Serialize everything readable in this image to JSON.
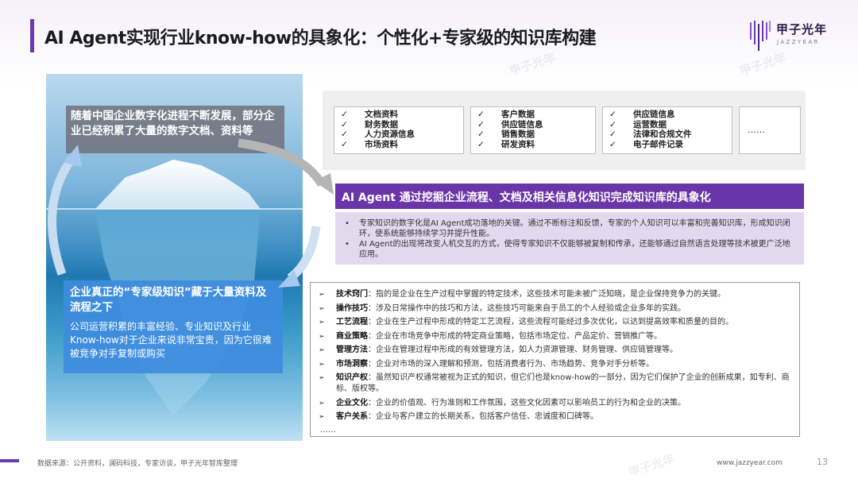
{
  "title": "AI Agent实现行业know-how的具象化：个性化+专家级的知识库构建",
  "logo": {
    "zh": "甲子光年",
    "en": "JAZZYEAR",
    "watermark": "甲子光年"
  },
  "iceberg": {
    "top_text": "随着中国企业数字化进程不断发展，部分企业已经积累了大量的数字文档、资料等",
    "bottom_heading": "企业真正的“专家级知识”藏于大量资料及流程之下",
    "bottom_body": "公司运营积累的丰富经验、专业知识及行业Know-how对于企业来说非常宝贵，因为它很难被竞争对手复制或购买"
  },
  "categories": [
    {
      "items": [
        "文档资料",
        "财务数据",
        "人力资源信息",
        "市场资料"
      ]
    },
    {
      "items": [
        "客户数据",
        "供应链信息",
        "销售数据",
        "研发资料"
      ]
    },
    {
      "items": [
        "供应链信息",
        "运营数据",
        "法律和合规文件",
        "电子邮件记录"
      ]
    }
  ],
  "categories_more": "……",
  "check_glyph": "✓",
  "purple": {
    "heading": "AI Agent 通过挖掘企业流程、文档及相关信息化知识完成知识库的具象化",
    "bullet": "•",
    "points": [
      "专家知识的数字化是AI Agent成功落地的关键。通过不断标注和反馈，专家的个人知识可以丰富和完善知识库，形成知识闭环，使系统能够持续学习并提升性能。",
      "AI Agent的出现将改变人机交互的方式，使得专家知识不仅能够被复制和传承，还能够通过自然语言处理等技术被更广泛地应用。"
    ]
  },
  "knowledge": {
    "arrow": "➢",
    "items": [
      {
        "term": "技术窍门",
        "desc": "：指的是企业在生产过程中掌握的特定技术，这些技术可能未被广泛知晓，是企业保持竞争力的关键。"
      },
      {
        "term": "操作技巧",
        "desc": "：涉及日常操作中的技巧和方法，这些技巧可能来自于员工的个人经验或企业多年的实践。"
      },
      {
        "term": "工艺流程",
        "desc": "：企业在生产过程中形成的特定工艺流程，这些流程可能经过多次优化，以达到提高效率和质量的目的。"
      },
      {
        "term": "商业策略",
        "desc": "：企业在市场竞争中形成的特定商业策略，包括市场定位、产品定价、营销推广等。"
      },
      {
        "term": "管理方法",
        "desc": "：企业在管理过程中形成的有效管理方法，如人力资源管理、财务管理、供应链管理等。"
      },
      {
        "term": "市场洞察",
        "desc": "：企业对市场的深入理解和预测，包括消费者行为、市场趋势、竞争对手分析等。"
      },
      {
        "term": "知识产权",
        "desc": "：虽然知识产权通常被视为正式的知识，但它们也是know-how的一部分，因为它们保护了企业的创新成果，如专利、商标、版权等。"
      },
      {
        "term": "企业文化",
        "desc": "：企业的价值观、行为准则和工作氛围，这些文化因素可以影响员工的行为和企业的决策。"
      },
      {
        "term": "客户关系",
        "desc": "：企业与客户建立的长期关系，包括客户信任、忠诚度和口碑等。"
      }
    ],
    "more": "……"
  },
  "footer": {
    "source": "数据来源：公开资料，澜码科技，专家访谈，甲子光年智库整理",
    "url": "www.jazzyear.com",
    "page": "13"
  },
  "colors": {
    "accent": "#6a35a8",
    "blue_box": "#3e8cde",
    "gray_box": "#6e6e76"
  }
}
